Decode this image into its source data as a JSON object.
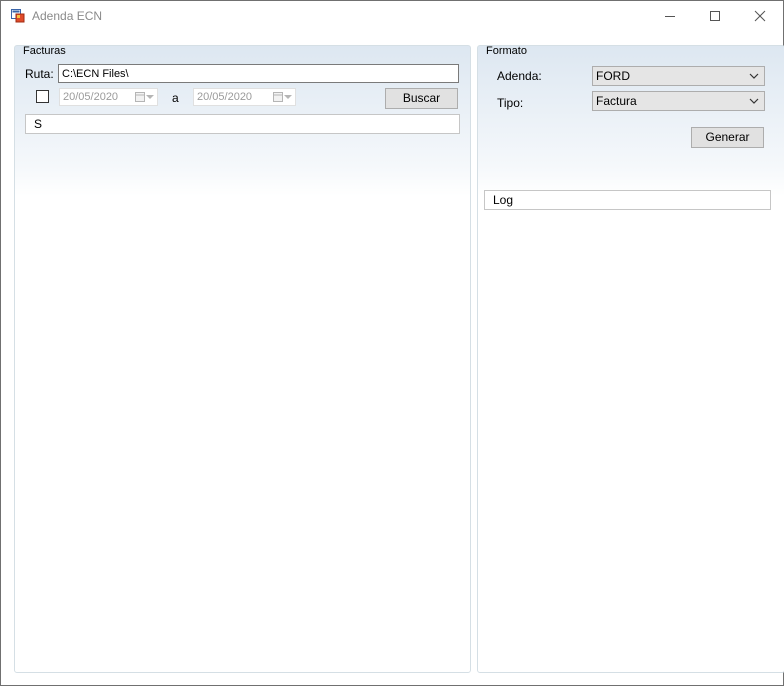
{
  "window": {
    "title": "Adenda ECN"
  },
  "facturas": {
    "group_label": "Facturas",
    "ruta_label": "Ruta:",
    "ruta_value": "C:\\ECN Files\\",
    "date_from": "20/05/2020",
    "date_separator": "a",
    "date_to": "20/05/2020",
    "buscar_label": "Buscar",
    "list_header": "S"
  },
  "formato": {
    "group_label": "Formato",
    "adenda_label": "Adenda:",
    "adenda_value": "FORD",
    "tipo_label": "Tipo:",
    "tipo_value": "Factura",
    "generar_label": "Generar",
    "log_header": "Log"
  },
  "icons": {
    "app": "app-window-icon",
    "minimize": "minimize-icon",
    "maximize": "maximize-icon",
    "close": "close-icon",
    "calendar": "calendar-icon",
    "dropdown": "chevron-down-icon"
  }
}
